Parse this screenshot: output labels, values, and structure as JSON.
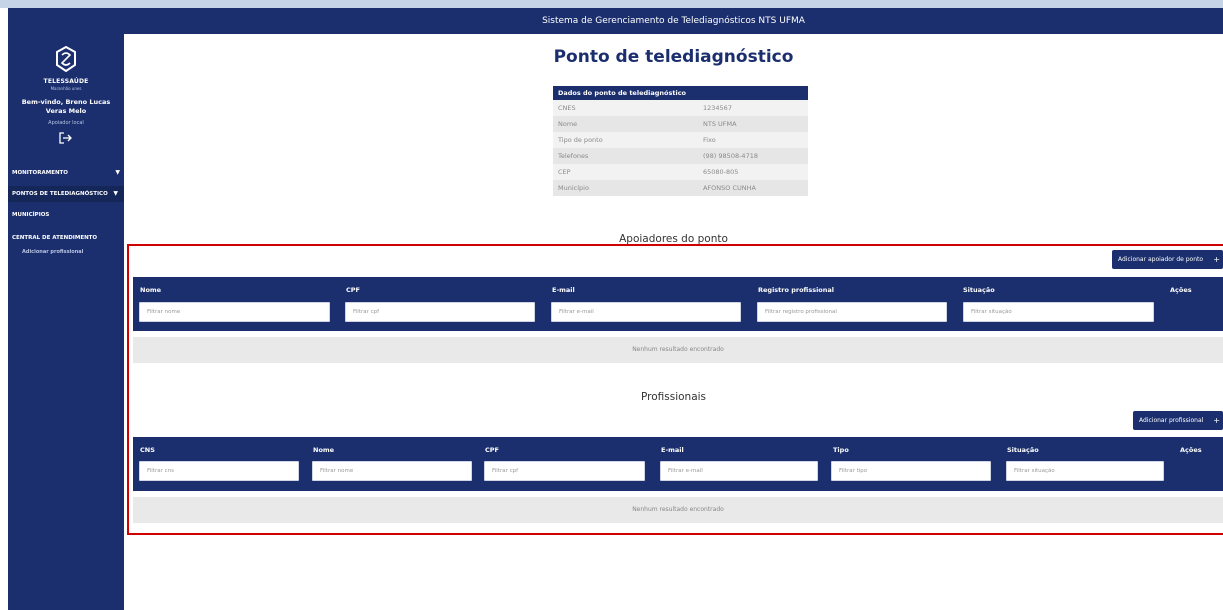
{
  "header": {
    "title": "Sistema de Gerenciamento de Telediagnósticos NTS UFMA"
  },
  "sidebar": {
    "brand": "TELESSAÚDE",
    "brand_sub": "Maranhão unes",
    "welcome": "Bem-vindo, Breno Lucas Veras Melo",
    "role": "Apoiador local",
    "logout_icon": "logout-icon",
    "items": [
      {
        "label": "MONITORAMENTO",
        "has_arrow": true
      },
      {
        "label": "PONTOS DE TELEDIAGNÓSTICO",
        "has_arrow": true,
        "active": true
      },
      {
        "label": "MUNICÍPIOS",
        "has_arrow": false
      },
      {
        "label": "CENTRAL DE ATENDIMENTO",
        "has_arrow": false
      }
    ],
    "arrow_glyph": "▼",
    "sub_item": "Adicionar profissional"
  },
  "page": {
    "title": "Ponto de telediagnóstico"
  },
  "info_card": {
    "title": "Dados do ponto de telediagnóstico",
    "rows": [
      {
        "label": "CNES",
        "value": "1234567"
      },
      {
        "label": "Nome",
        "value": "NTS UFMA"
      },
      {
        "label": "Tipo de ponto",
        "value": "Fixo"
      },
      {
        "label": "Telefones",
        "value": "(98) 98508-4718"
      },
      {
        "label": "CEP",
        "value": "65080-805"
      },
      {
        "label": "Município",
        "value": "AFONSO CUNHA"
      }
    ]
  },
  "apoiadores": {
    "title": "Apoiadores do ponto",
    "add_button": "Adicionar apoiador de ponto",
    "plus": "+",
    "columns": [
      {
        "label": "Nome",
        "placeholder": "Filtrar nome"
      },
      {
        "label": "CPF",
        "placeholder": "Filtrar cpf"
      },
      {
        "label": "E-mail",
        "placeholder": "Filtrar e-mail"
      },
      {
        "label": "Registro profissional",
        "placeholder": "Filtrar registro profissional"
      },
      {
        "label": "Situação",
        "placeholder": "Filtrar situação"
      },
      {
        "label": "Ações"
      }
    ],
    "empty": "Nenhum resultado encontrado"
  },
  "profissionais": {
    "title": "Profissionais",
    "add_button": "Adicionar profissional",
    "plus": "+",
    "columns": [
      {
        "label": "CNS",
        "placeholder": "Filtrar cns"
      },
      {
        "label": "Nome",
        "placeholder": "Filtrar nome"
      },
      {
        "label": "CPF",
        "placeholder": "Filtrar cpf"
      },
      {
        "label": "E-mail",
        "placeholder": "Filtrar e-mail"
      },
      {
        "label": "Tipo",
        "placeholder": "Filtrar tipo"
      },
      {
        "label": "Situação",
        "placeholder": "Filtrar situação"
      },
      {
        "label": "Ações"
      }
    ],
    "empty": "Nenhum resultado encontrado"
  },
  "colors": {
    "primary": "#1b2f6e",
    "highlight": "#d10000"
  }
}
